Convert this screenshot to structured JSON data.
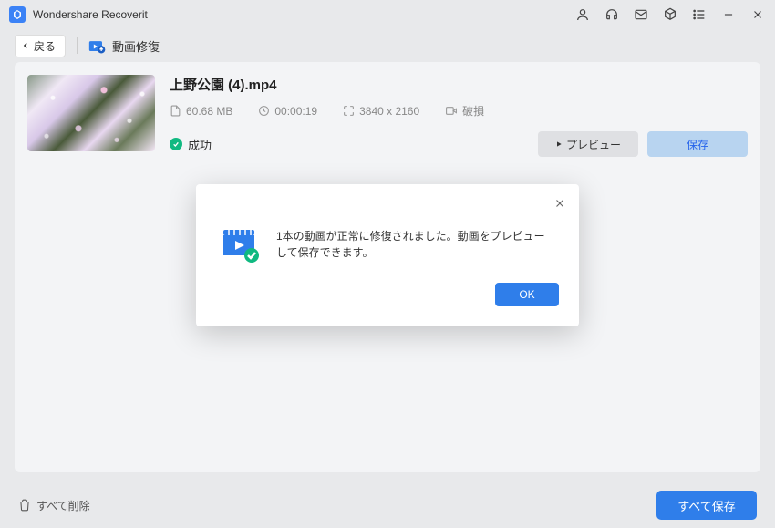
{
  "app": {
    "title": "Wondershare Recoverit"
  },
  "toolbar": {
    "back_label": "戻る",
    "feature_label": "動画修復"
  },
  "file": {
    "name": "上野公園 (4).mp4",
    "size": "60.68  MB",
    "duration": "00:00:19",
    "resolution": "3840 x 2160",
    "condition": "破損",
    "status": "成功"
  },
  "buttons": {
    "preview": "プレビュー",
    "save": "保存"
  },
  "footer": {
    "delete_all": "すべて削除",
    "save_all": "すべて保存"
  },
  "modal": {
    "message": "1本の動画が正常に修復されました。動画をプレビューして保存できます。",
    "ok": "OK"
  }
}
